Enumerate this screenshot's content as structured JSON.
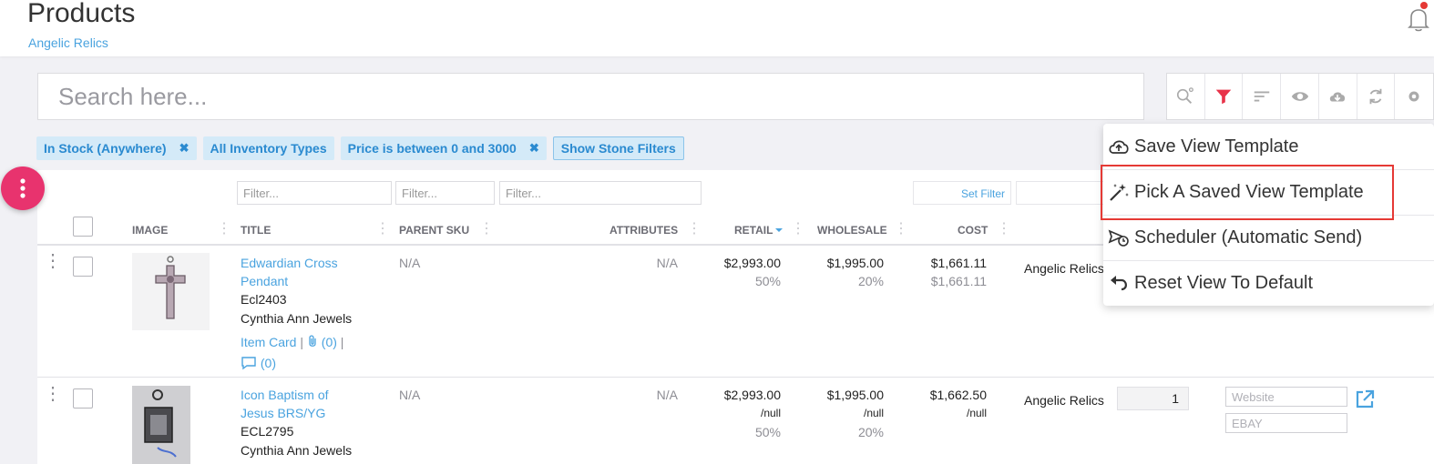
{
  "header": {
    "title": "Products",
    "store": "Angelic Relics"
  },
  "search": {
    "placeholder": "Search here..."
  },
  "toolbar": {
    "icons": [
      "search-settings-icon",
      "filter-icon",
      "sort-icon",
      "eye-icon",
      "cloud-download-icon",
      "refresh-icon",
      "settings-icon"
    ],
    "accent": "#e8334a"
  },
  "chips": [
    {
      "label": "In Stock (Anywhere)",
      "removable": true
    },
    {
      "label": "All Inventory Types",
      "removable": false
    },
    {
      "label": "Price is between 0 and 3000",
      "removable": true
    },
    {
      "label": "Show Stone Filters",
      "removable": false
    }
  ],
  "filters": {
    "placeholder": "Filter...",
    "set_filter": "Set Filter"
  },
  "columns": {
    "image": "IMAGE",
    "title": "TITLE",
    "parent_sku": "PARENT SKU",
    "attributes": "ATTRIBUTES",
    "retail": "RETAIL",
    "wholesale": "WHOLESALE",
    "cost": "COST"
  },
  "rows": [
    {
      "title_line1": "Edwardian Cross",
      "title_line2": "Pendant",
      "sku": "Ecl2403",
      "vendor": "Cynthia Ann Jewels",
      "item_card": "Item Card",
      "attachments": "(0)",
      "comments": "(0)",
      "parent_sku": "N/A",
      "attributes": "N/A",
      "retail": "$2,993.00",
      "retail_pct": "50%",
      "wholesale": "$1,995.00",
      "wholesale_pct": "20%",
      "cost": "$1,661.11",
      "cost_sub": "$1,661.11",
      "location": "Angelic Relics"
    },
    {
      "title_line1": "Icon Baptism of",
      "title_line2": "Jesus BRS/YG",
      "sku": "ECL2795",
      "vendor": "Cynthia Ann Jewels",
      "parent_sku": "N/A",
      "attributes": "N/A",
      "retail": "$2,993.00",
      "retail_null": "/null",
      "retail_pct": "50%",
      "wholesale": "$1,995.00",
      "wholesale_null": "/null",
      "wholesale_pct": "20%",
      "cost": "$1,662.50",
      "cost_null": "/null",
      "location": "Angelic Relics",
      "qty": "1",
      "channel1": "Website",
      "channel2": "EBAY"
    }
  ],
  "menu": {
    "items": [
      {
        "label": "Save View Template",
        "icon": "cloud-upload-icon"
      },
      {
        "label": "Pick A Saved View Template",
        "icon": "magic-wand-icon"
      },
      {
        "label": "Scheduler (Automatic Send)",
        "icon": "scheduler-icon"
      },
      {
        "label": "Reset View To Default",
        "icon": "undo-icon"
      }
    ]
  }
}
